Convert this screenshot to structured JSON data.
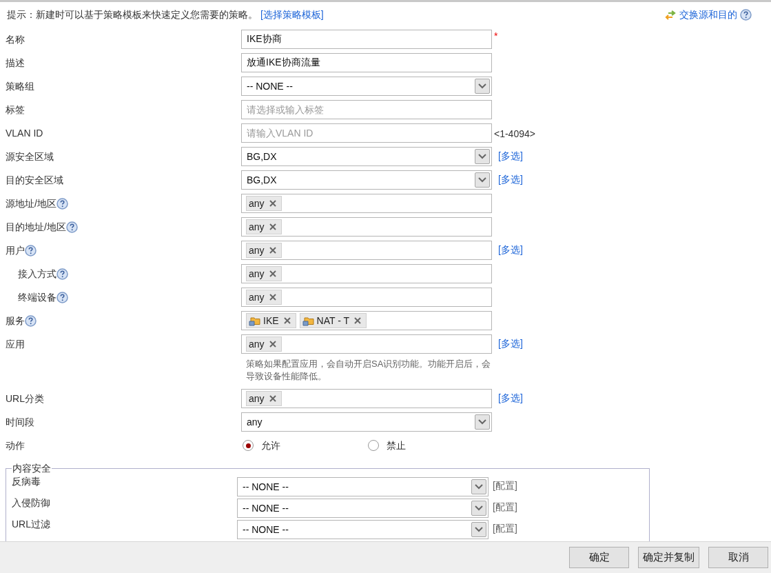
{
  "hint": {
    "text": "提示：新建时可以基于策略模板来快速定义您需要的策略。",
    "link": "[选择策略模板]"
  },
  "swap_link": "交换源和目的",
  "fields": [
    {
      "kind": "text",
      "label": "名称",
      "value": "IKE协商",
      "mark": "*"
    },
    {
      "kind": "text",
      "label": "描述",
      "value": "放通IKE协商流量"
    },
    {
      "kind": "select",
      "label": "策略组",
      "value": "-- NONE --"
    },
    {
      "kind": "text",
      "label": "标签",
      "placeholder": "请选择或输入标签"
    },
    {
      "kind": "text",
      "label": "VLAN ID",
      "placeholder": "请输入VLAN ID",
      "suffix": "<1-4094>"
    },
    {
      "kind": "select",
      "label": "源安全区域",
      "value": "BG,DX",
      "link": "[多选]"
    },
    {
      "kind": "select",
      "label": "目的安全区域",
      "value": "BG,DX",
      "link": "[多选]"
    },
    {
      "kind": "tags",
      "label": "源地址/地区",
      "help": true,
      "tags": [
        {
          "text": "any",
          "icon": false
        }
      ]
    },
    {
      "kind": "tags",
      "label": "目的地址/地区",
      "help": true,
      "tags": [
        {
          "text": "any",
          "icon": false
        }
      ]
    },
    {
      "kind": "tags",
      "label": "用户",
      "help": true,
      "link": "[多选]",
      "tags": [
        {
          "text": "any",
          "icon": false
        }
      ],
      "children": [
        {
          "kind": "tags",
          "label": "接入方式",
          "help": true,
          "tags": [
            {
              "text": "any",
              "icon": false
            }
          ]
        },
        {
          "kind": "tags",
          "label": "终端设备",
          "help": true,
          "tags": [
            {
              "text": "any",
              "icon": false
            }
          ]
        }
      ]
    },
    {
      "kind": "tags",
      "label": "服务",
      "help": true,
      "tags": [
        {
          "text": "IKE",
          "icon": true
        },
        {
          "text": "NAT - T",
          "icon": true
        }
      ]
    },
    {
      "kind": "tags",
      "label": "应用",
      "link": "[多选]",
      "tags": [
        {
          "text": "any",
          "icon": false
        }
      ],
      "note": "策略如果配置应用，会自动开启SA识别功能。功能开启后，会导致设备性能降低。"
    },
    {
      "kind": "tags",
      "label": "URL分类",
      "link": "[多选]",
      "tags": [
        {
          "text": "any",
          "icon": false
        }
      ]
    },
    {
      "kind": "select",
      "label": "时间段",
      "value": "any"
    },
    {
      "kind": "radio",
      "label": "动作",
      "options": [
        {
          "label": "允许",
          "selected": true
        },
        {
          "label": "禁止",
          "selected": false
        }
      ]
    }
  ],
  "content_security": {
    "legend": "内容安全",
    "rows": [
      {
        "label": "反病毒",
        "value": "-- NONE --",
        "link": "[配置]"
      },
      {
        "label": "入侵防御",
        "value": "-- NONE --",
        "link": "[配置]"
      },
      {
        "label": "URL过滤",
        "value": "-- NONE --",
        "link": "[配置]"
      }
    ]
  },
  "buttons": [
    "确定",
    "确定并复制",
    "取消"
  ]
}
